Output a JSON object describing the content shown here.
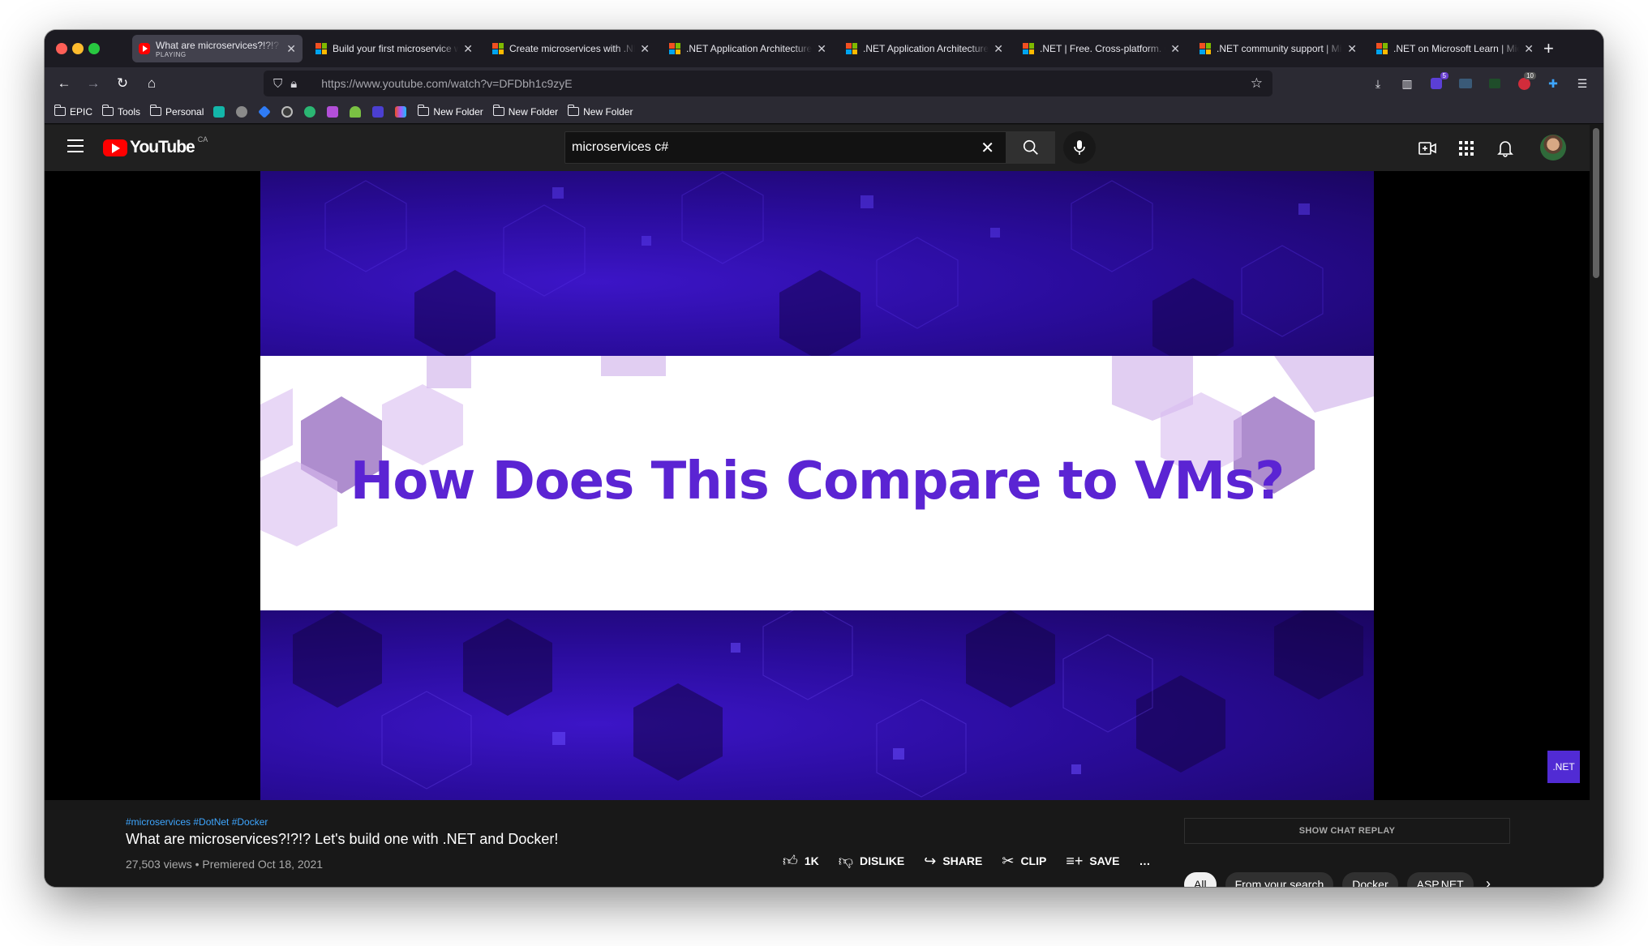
{
  "browser": {
    "tabs": [
      {
        "title": "What are microservices?!?!? Let's build one with .NET and Docker!",
        "sub": "PLAYING",
        "favicon": "youtube-icon",
        "active": true
      },
      {
        "title": "Build your first microservice with .NET",
        "favicon": "microsoft-icon"
      },
      {
        "title": "Create microservices with .NET and ASP.NET Core",
        "favicon": "microsoft-icon"
      },
      {
        "title": ".NET Application Architecture Guides",
        "favicon": "microsoft-icon"
      },
      {
        "title": ".NET Application Architecture Guides",
        "favicon": "microsoft-icon"
      },
      {
        "title": ".NET | Free. Cross-platform. Open Source.",
        "favicon": "microsoft-icon"
      },
      {
        "title": ".NET community support | Microsoft",
        "favicon": "microsoft-icon"
      },
      {
        "title": ".NET on Microsoft Learn | Microsoft",
        "favicon": "microsoft-icon"
      }
    ],
    "url_host": "https://www.youtube.com",
    "url_path": "/watch?v=DFDbh1c9zyE",
    "badges": {
      "ext1": "5",
      "ext2": "10"
    },
    "bookmarks": [
      {
        "label": "EPIC",
        "type": "folder"
      },
      {
        "label": "Tools",
        "type": "folder"
      },
      {
        "label": "Personal",
        "type": "folder"
      }
    ],
    "bookmark_folders_end": [
      "New Folder",
      "New Folder",
      "New Folder"
    ]
  },
  "youtube": {
    "logo_text": "YouTube",
    "country": "CA",
    "search_value": "microservices c#",
    "video": {
      "slide_title": "How Does This Compare to VMs?",
      "watermark": ".NET",
      "tags": "#microservices #DotNet #Docker",
      "title": "What are microservices?!?!? Let's build one with .NET and Docker!",
      "meta": "27,503 views • Premiered Oct 18, 2021"
    },
    "actions": {
      "like": "1K",
      "dislike": "DISLIKE",
      "share": "SHARE",
      "clip": "CLIP",
      "save": "SAVE",
      "more": "…"
    },
    "chat_replay": "SHOW CHAT REPLAY",
    "chips": [
      "All",
      "From your search",
      "Docker",
      "ASP.NET"
    ],
    "colors": {
      "brand_red": "#ff0000",
      "slide_purple": "#5b24d3",
      "link_blue": "#3ea6ff",
      "dotnet_purple": "#512bd4"
    }
  }
}
